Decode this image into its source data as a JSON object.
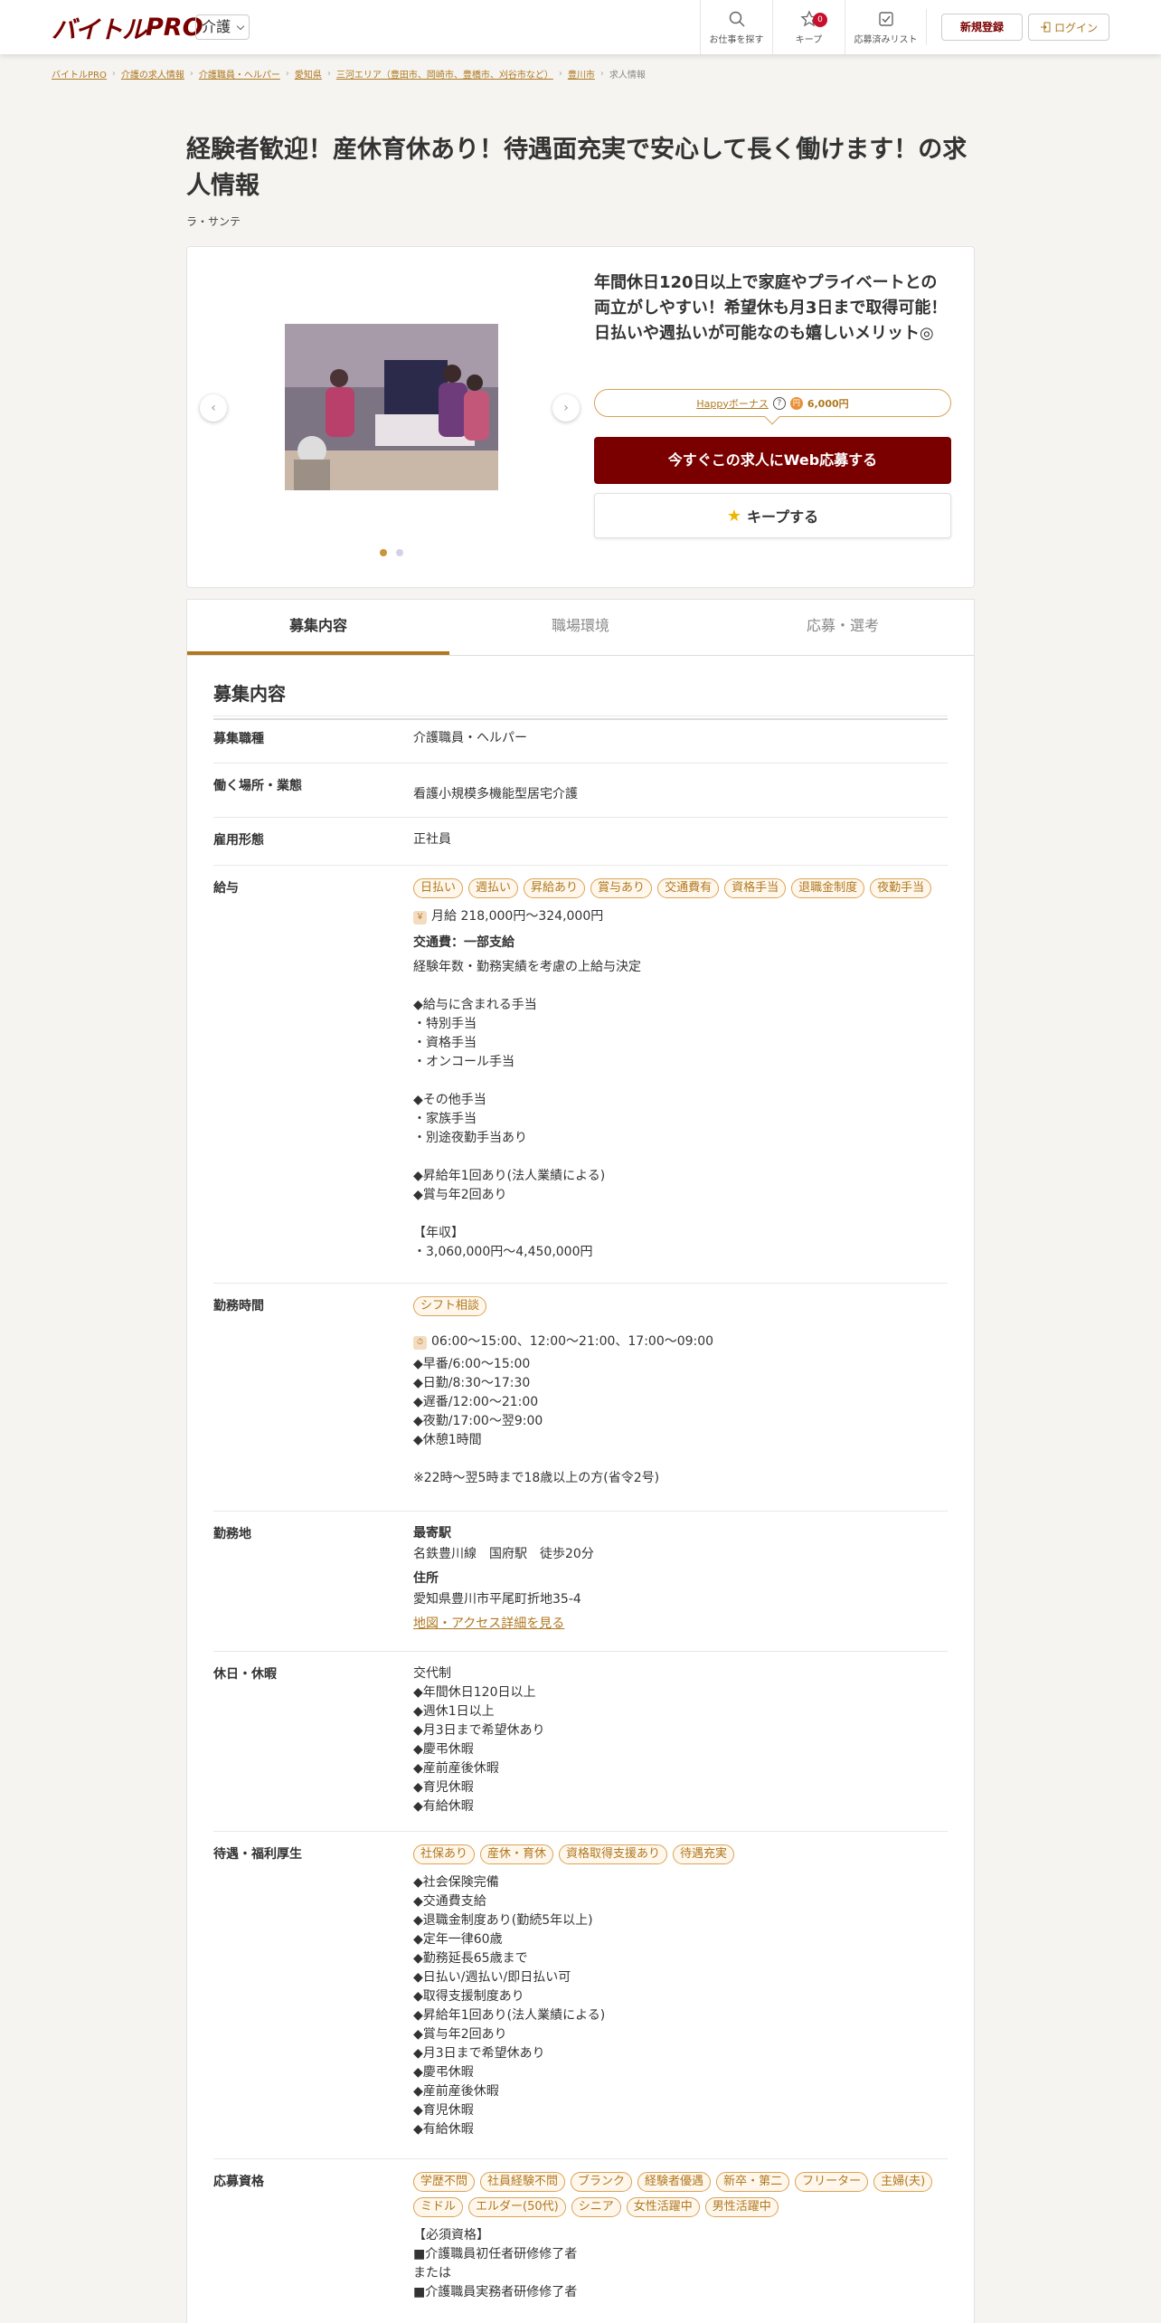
{
  "header": {
    "logo_main": "バイトル",
    "logo_pro": "PRO",
    "category": "介護",
    "nav": [
      {
        "label": "お仕事を探す",
        "icon": "search-icon"
      },
      {
        "label": "キープ",
        "icon": "star-icon",
        "badge": "0"
      },
      {
        "label": "応募済みリスト",
        "icon": "check-icon"
      }
    ],
    "register_label": "新規登録",
    "login_label": "ログイン"
  },
  "breadcrumb": [
    "バイトルPRO",
    "介護の求人情報",
    "介護職員・ヘルパー",
    "愛知県",
    "三河エリア（豊田市、岡崎市、豊橋市、刈谷市など）",
    "豊川市",
    "求人情報"
  ],
  "page": {
    "title": "経験者歓迎！産休育休あり！待遇面充実で安心して長く働けます！の求人情報",
    "company": "ラ・サンテ"
  },
  "hero": {
    "catch": "年間休日120日以上で家庭やプライベートとの両立がしやすい！希望休も月3日まで取得可能！日払いや週払いが可能なのも嬉しいメリット◎",
    "bonus_link": "Happyボーナス",
    "bonus_amount": "6,000円",
    "apply_label": "今すぐこの求人にWeb応募する",
    "keep_label": "キープする",
    "slide_count": 2,
    "active_slide": 1
  },
  "tabs": [
    "募集内容",
    "職場環境",
    "応募・選考"
  ],
  "section_title": "募集内容",
  "rows": {
    "job_type": {
      "label": "募集職種",
      "value": "介護職員・ヘルパー"
    },
    "workplace": {
      "label": "働く場所・業態",
      "value": "看護小規模多機能型居宅介護"
    },
    "employment": {
      "label": "雇用形態",
      "value": "正社員"
    },
    "salary": {
      "label": "給与",
      "tags": [
        "日払い",
        "週払い",
        "昇給あり",
        "賞与あり",
        "交通費有",
        "資格手当",
        "退職金制度",
        "夜勤手当"
      ],
      "amount": "月給 218,000円〜324,000円",
      "transport": "交通費：一部支給",
      "detail": "経験年数・勤務実績を考慮の上給与決定\n\n◆給与に含まれる手当\n・特別手当\n・資格手当\n・オンコール手当\n\n◆その他手当\n・家族手当\n・別途夜勤手当あり\n\n◆昇給年1回あり(法人業績による)\n◆賞与年2回あり\n\n【年収】\n・3,060,000円～4,450,000円"
    },
    "hours": {
      "label": "勤務時間",
      "tags": [
        "シフト相談"
      ],
      "time": "06:00〜15:00、12:00〜21:00、17:00〜09:00",
      "detail": "◆早番/6:00～15:00\n◆日勤/8:30～17:30\n◆遅番/12:00～21:00\n◆夜勤/17:00～翌9:00\n◆休憩1時間\n\n※22時～翌5時まで18歳以上の方(省令2号)"
    },
    "location": {
      "label": "勤務地",
      "station_heading": "最寄駅",
      "station": "名鉄豊川線　国府駅　徒歩20分",
      "address_heading": "住所",
      "address": "愛知県豊川市平尾町折地35-4",
      "map_link": "地図・アクセス詳細を見る"
    },
    "holidays": {
      "label": "休日・休暇",
      "detail": "交代制\n◆年間休日120日以上\n◆週休1日以上\n◆月3日まで希望休あり\n◆慶弔休暇\n◆産前産後休暇\n◆育児休暇\n◆有給休暇"
    },
    "benefits": {
      "label": "待遇・福利厚生",
      "tags": [
        "社保あり",
        "産休・育休",
        "資格取得支援あり",
        "待遇充実"
      ],
      "detail": "◆社会保険完備\n◆交通費支給\n◆退職金制度あり(勤続5年以上)\n◆定年一律60歳\n◆勤務延長65歳まで\n◆日払い/週払い/即日払い可\n◆取得支援制度あり\n◆昇給年1回あり(法人業績による)\n◆賞与年2回あり\n◆月3日まで希望休あり\n◆慶弔休暇\n◆産前産後休暇\n◆育児休暇\n◆有給休暇"
    },
    "qualifications": {
      "label": "応募資格",
      "tags": [
        "学歴不問",
        "社員経験不問",
        "ブランク",
        "経験者優遇",
        "新卒・第二",
        "フリーター",
        "主婦(夫)",
        "ミドル",
        "エルダー(50代)",
        "シニア",
        "女性活躍中",
        "男性活躍中"
      ],
      "detail": "【必須資格】\n■介護職員初任者研修修了者\nまたは\n■介護職員実務者研修修了者"
    }
  }
}
